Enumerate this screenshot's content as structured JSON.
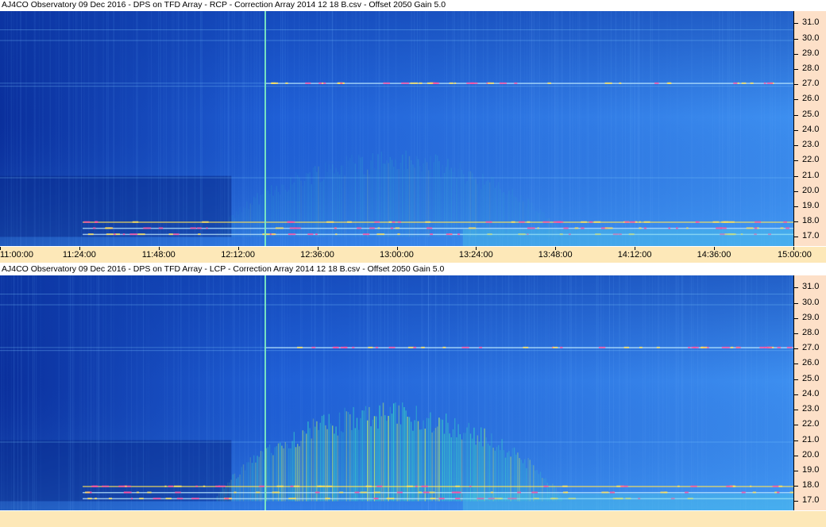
{
  "colors": {
    "background_low": "#0a2f9c",
    "background_mid": "#1f5fd6",
    "background_high": "#3d8ff0",
    "burst": "#39d7c4",
    "burst_hot": "#b8f26a",
    "rfi_line": "#ffe15a",
    "rfi_pink": "#ff4fa3",
    "axis_bg": "#fde0c8",
    "time_axis_bg": "#fde8b8"
  },
  "chart_data": [
    {
      "type": "heatmap",
      "title": "AJ4CO Observatory 09 Dec 2016  -  DPS on TFD Array  -  RCP  -  Correction Array 2014 12 18 B.csv  -  Offset 2050  Gain 5.0",
      "polarization": "RCP",
      "ylabel": "",
      "xlabel": "",
      "yticks": [
        "31.0",
        "30.0",
        "29.0",
        "28.0",
        "27.0",
        "26.0",
        "25.0",
        "24.0",
        "23.0",
        "22.0",
        "21.0",
        "20.0",
        "19.0",
        "18.0",
        "17.0"
      ],
      "ylim": [
        16.4,
        31.8
      ],
      "xticks": [
        "11:00:00",
        "11:24:00",
        "11:48:00",
        "12:12:00",
        "12:36:00",
        "13:00:00",
        "13:24:00",
        "13:48:00",
        "14:12:00",
        "14:36:00",
        "15:00:00"
      ],
      "xlim": [
        "11:00:00",
        "15:00:00"
      ],
      "grid": false,
      "intensity_scale": "colormap",
      "burst_event": {
        "start": "12:05:00",
        "end": "13:50:00",
        "freq_low": 17.0,
        "freq_high": 22.5,
        "peak_time": "12:55:00",
        "relative_strength": 0.25
      },
      "vertical_marker_time": "12:20:00",
      "rfi_bands": [
        17.2,
        17.6,
        18.0,
        27.1
      ]
    },
    {
      "type": "heatmap",
      "title": "AJ4CO Observatory 09 Dec 2016  -  DPS on TFD Array  -  LCP  -  Correction Array 2014 12 18 B.csv  -  Offset 2050  Gain 5.0",
      "polarization": "LCP",
      "ylabel": "",
      "xlabel": "",
      "yticks": [
        "31.0",
        "30.0",
        "29.0",
        "28.0",
        "27.0",
        "26.0",
        "25.0",
        "24.0",
        "23.0",
        "22.0",
        "21.0",
        "20.0",
        "19.0",
        "18.0",
        "17.0"
      ],
      "ylim": [
        16.4,
        31.8
      ],
      "grid": false,
      "intensity_scale": "colormap",
      "burst_event": {
        "start": "12:05:00",
        "end": "13:50:00",
        "freq_low": 17.0,
        "freq_high": 23.2,
        "peak_time": "12:55:00",
        "relative_strength": 1.0
      },
      "vertical_marker_time": "12:20:00",
      "rfi_bands": [
        17.2,
        17.6,
        18.0,
        27.1
      ]
    }
  ]
}
